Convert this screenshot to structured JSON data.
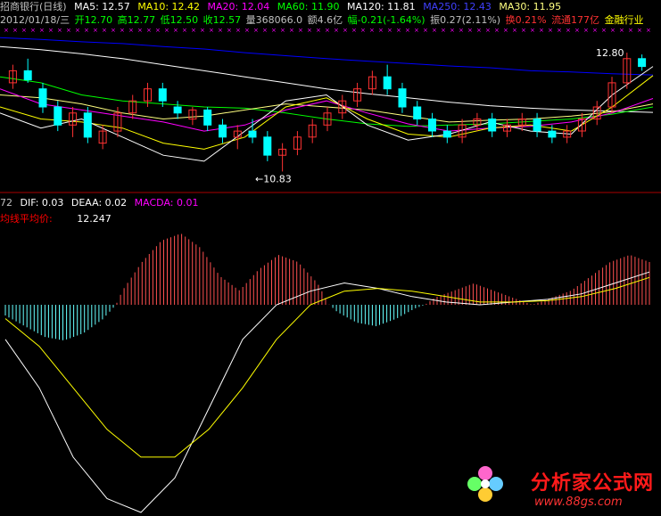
{
  "header": {
    "stock_name": "招商银行(日线)",
    "ma5": "MA5: 12.57",
    "ma10": "MA10: 12.42",
    "ma20": "MA20: 12.04",
    "ma60": "MA60: 11.90",
    "ma120": "MA120: 11.81",
    "ma250": "MA250: 12.43",
    "ma30": "MA30: 11.95",
    "date": "2012/01/18/三",
    "open": "开12.70",
    "high": "高12.77",
    "low": "低12.50",
    "close": "收12.57",
    "volume": "量368066.0",
    "amount": "额4.6亿",
    "change": "幅-0.21(-1.64%)",
    "amplitude": "振0.27(2.11%)",
    "turnover": "换0.21%",
    "float": "流通177亿",
    "industry": "金融行业"
  },
  "price_labels": {
    "high_mark": "12.80",
    "low_mark": "←10.83"
  },
  "macd_header": {
    "prefix": "72",
    "dif": "DIF: 0.03",
    "dea": "DEAA: 0.02",
    "macd": "MACDA: 0.01",
    "avg_label": "均线平均价:",
    "avg_value": "12.247"
  },
  "colors": {
    "background": "#000000",
    "ma5": "#ffffff",
    "ma10": "#ffff00",
    "ma20": "#ff00ff",
    "ma60": "#00ff00",
    "ma120": "#ffffff",
    "ma250": "#0000ff",
    "ma30": "#ffff80",
    "up_candle": "#ff3232",
    "down_candle": "#00ffff",
    "text_label": "#c0c0c0",
    "red_label": "#ff0000",
    "magenta_label": "#ff00ff",
    "green_label": "#00ff00",
    "blue_label": "#4040ff",
    "dif": "#ffffff",
    "dea": "#ffff00"
  },
  "watermark": {
    "title": "分析家公式网",
    "url": "www.88gs.com"
  },
  "chart_data": [
    {
      "type": "candlestick",
      "title": "招商银行(日线)",
      "ylim": [
        10.6,
        13.2
      ],
      "series_names": [
        "MA5",
        "MA10",
        "MA20",
        "MA60",
        "MA120",
        "MA250",
        "MA30"
      ],
      "ma250": [
        13.05,
        13.02,
        12.98,
        12.95,
        12.9,
        12.86,
        12.8,
        12.75,
        12.7,
        12.66,
        12.62,
        12.58,
        12.55,
        12.5,
        12.48,
        12.45,
        12.43
      ],
      "ma120": [
        12.9,
        12.85,
        12.78,
        12.7,
        12.6,
        12.5,
        12.4,
        12.3,
        12.2,
        12.12,
        12.05,
        11.98,
        11.92,
        11.88,
        11.85,
        11.83,
        11.81
      ],
      "ma60": [
        12.4,
        12.3,
        12.1,
        12.0,
        11.95,
        11.9,
        11.88,
        11.8,
        11.7,
        11.62,
        11.58,
        11.6,
        11.62,
        11.66,
        11.7,
        11.78,
        11.9
      ],
      "ma30": [
        12.1,
        12.05,
        11.95,
        11.8,
        11.7,
        11.75,
        11.85,
        11.95,
        11.9,
        11.85,
        11.75,
        11.65,
        11.68,
        11.7,
        11.75,
        11.82,
        11.95
      ],
      "ma20": [
        12.2,
        11.95,
        11.85,
        11.75,
        11.65,
        11.5,
        11.6,
        11.85,
        12.0,
        11.8,
        11.62,
        11.5,
        11.55,
        11.58,
        11.65,
        11.8,
        12.04
      ],
      "ma10": [
        11.9,
        11.7,
        11.65,
        11.55,
        11.3,
        11.2,
        11.4,
        11.9,
        12.05,
        11.7,
        11.45,
        11.4,
        11.55,
        11.6,
        11.5,
        11.9,
        12.42
      ],
      "ma5": [
        11.8,
        11.55,
        11.7,
        11.4,
        11.1,
        11.0,
        11.5,
        12.0,
        12.1,
        11.6,
        11.35,
        11.45,
        11.65,
        11.5,
        11.45,
        12.1,
        12.57
      ],
      "candles": [
        [
          12.3,
          12.6,
          12.2,
          12.5
        ],
        [
          12.5,
          12.7,
          12.3,
          12.35
        ],
        [
          12.2,
          12.3,
          11.8,
          11.9
        ],
        [
          11.9,
          12.0,
          11.5,
          11.6
        ],
        [
          11.6,
          11.9,
          11.4,
          11.8
        ],
        [
          11.8,
          11.9,
          11.3,
          11.4
        ],
        [
          11.3,
          11.6,
          11.2,
          11.5
        ],
        [
          11.5,
          11.9,
          11.4,
          11.8
        ],
        [
          11.8,
          12.1,
          11.7,
          12.0
        ],
        [
          12.0,
          12.3,
          11.9,
          12.2
        ],
        [
          12.2,
          12.3,
          11.9,
          12.0
        ],
        [
          11.9,
          12.0,
          11.7,
          11.8
        ],
        [
          11.7,
          11.9,
          11.6,
          11.85
        ],
        [
          11.85,
          11.9,
          11.5,
          11.6
        ],
        [
          11.6,
          11.7,
          11.3,
          11.4
        ],
        [
          11.4,
          11.6,
          11.2,
          11.5
        ],
        [
          11.5,
          11.7,
          11.3,
          11.4
        ],
        [
          11.4,
          11.5,
          11.0,
          11.1
        ],
        [
          11.1,
          11.3,
          10.83,
          11.2
        ],
        [
          11.2,
          11.5,
          11.1,
          11.4
        ],
        [
          11.4,
          11.7,
          11.3,
          11.6
        ],
        [
          11.6,
          11.9,
          11.5,
          11.8
        ],
        [
          11.8,
          12.1,
          11.7,
          12.0
        ],
        [
          12.0,
          12.3,
          11.9,
          12.2
        ],
        [
          12.2,
          12.5,
          12.1,
          12.4
        ],
        [
          12.4,
          12.6,
          12.1,
          12.2
        ],
        [
          12.2,
          12.3,
          11.8,
          11.9
        ],
        [
          11.9,
          12.0,
          11.6,
          11.7
        ],
        [
          11.7,
          11.8,
          11.4,
          11.5
        ],
        [
          11.5,
          11.6,
          11.3,
          11.4
        ],
        [
          11.4,
          11.7,
          11.3,
          11.6
        ],
        [
          11.6,
          11.8,
          11.5,
          11.7
        ],
        [
          11.7,
          11.8,
          11.4,
          11.5
        ],
        [
          11.5,
          11.7,
          11.4,
          11.6
        ],
        [
          11.6,
          11.8,
          11.5,
          11.7
        ],
        [
          11.7,
          11.8,
          11.4,
          11.5
        ],
        [
          11.5,
          11.6,
          11.3,
          11.4
        ],
        [
          11.4,
          11.6,
          11.3,
          11.5
        ],
        [
          11.5,
          11.8,
          11.4,
          11.7
        ],
        [
          11.7,
          12.0,
          11.6,
          11.9
        ],
        [
          11.9,
          12.4,
          11.8,
          12.3
        ],
        [
          12.3,
          12.8,
          12.2,
          12.7
        ],
        [
          12.7,
          12.77,
          12.5,
          12.57
        ]
      ]
    },
    {
      "type": "bar",
      "title": "MACD",
      "ylim": [
        -0.3,
        0.3
      ],
      "series": [
        {
          "name": "DIF",
          "values": [
            -0.05,
            -0.12,
            -0.22,
            -0.28,
            -0.3,
            -0.25,
            -0.15,
            -0.05,
            0.0,
            0.05,
            0.08,
            0.06,
            0.03,
            0.01,
            0.0,
            0.01,
            0.02,
            0.04,
            0.08,
            0.12
          ]
        },
        {
          "name": "DEAA",
          "values": [
            -0.02,
            -0.06,
            -0.12,
            -0.18,
            -0.22,
            -0.22,
            -0.18,
            -0.12,
            -0.05,
            0.0,
            0.05,
            0.06,
            0.05,
            0.03,
            0.01,
            0.01,
            0.015,
            0.03,
            0.06,
            0.1
          ]
        }
      ],
      "histogram": [
        -0.03,
        -0.06,
        -0.09,
        -0.1,
        -0.08,
        -0.04,
        0.02,
        0.06,
        0.09,
        0.1,
        0.08,
        0.04,
        0.02,
        0.05,
        0.07,
        0.06,
        0.03,
        -0.02,
        -0.05,
        -0.06,
        -0.04,
        -0.01,
        0.01,
        0.02,
        0.03,
        0.02,
        0.01,
        0.0,
        0.01,
        0.02,
        0.04,
        0.06,
        0.07,
        0.06
      ]
    }
  ]
}
